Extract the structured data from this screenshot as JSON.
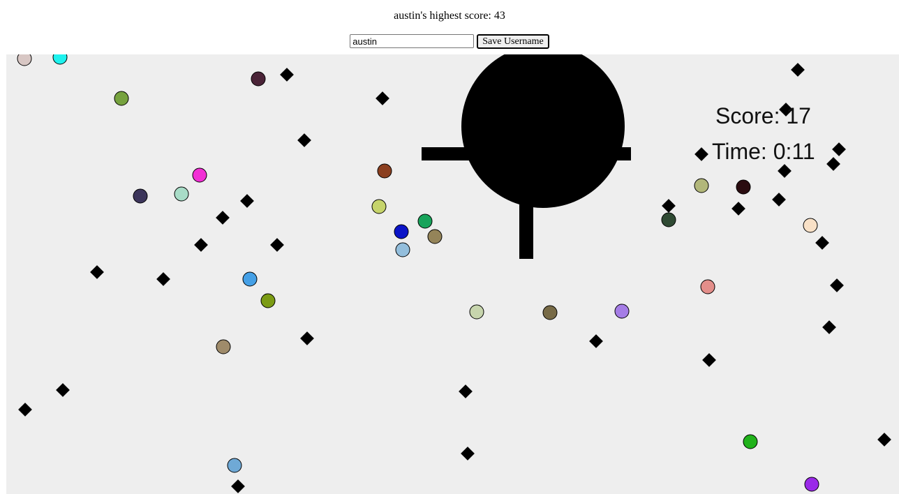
{
  "header": {
    "highscore_text": "austin's highest score: 43",
    "username_value": "austin",
    "save_label": "Save Username"
  },
  "hud": {
    "score_text": "Score: 17",
    "time_text": "Time: 0:11"
  },
  "colors": {
    "field": "#eeeeee",
    "player": "#000000",
    "obstacle": "#000000"
  }
}
